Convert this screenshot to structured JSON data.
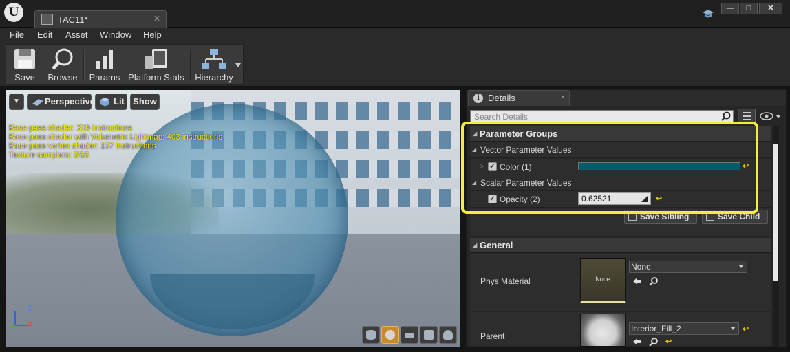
{
  "window": {
    "doc_tab_title": "TAC11*",
    "min_label": "—",
    "max_label": "□",
    "close_label": "✕"
  },
  "menu": [
    "File",
    "Edit",
    "Asset",
    "Window",
    "Help"
  ],
  "toolbar": {
    "save": "Save",
    "browse": "Browse",
    "params": "Params",
    "platform_stats": "Platform Stats",
    "hierarchy": "Hierarchy"
  },
  "viewport": {
    "menu_glyph": "▼",
    "perspective": "Perspective",
    "lit": "Lit",
    "show": "Show",
    "stats": [
      "Base pass shader: 319 instructions",
      "Base pass shader with Volumetric Lightmap: 403 instructions",
      "Base pass vertex shader: 137 instructions",
      "Texture samplers: 3/16"
    ],
    "axis_z": "Z",
    "axis_x": "X"
  },
  "details": {
    "tab_title": "Details",
    "tab_icon": "i",
    "tab_close": "×",
    "search_placeholder": "Search Details",
    "parameter_groups": {
      "title": "Parameter Groups",
      "vector_header": "Vector Parameter Values",
      "color_label": "Color (1)",
      "color_value": "#005e68",
      "scalar_header": "Scalar Parameter Values",
      "opacity_label": "Opacity (2)",
      "opacity_value": "0.62521",
      "save_sibling": "Save Sibling",
      "save_child": "Save Child"
    },
    "general": {
      "title": "General",
      "phys_material_label": "Phys Material",
      "phys_material_thumb": "None",
      "phys_material_value": "None",
      "parent_label": "Parent",
      "parent_value": "Interior_Fill_2"
    }
  },
  "colors": {
    "highlight": "#f3ee3a",
    "reset_arrow": "#e2c512",
    "stats_text": "#f2e12a"
  }
}
